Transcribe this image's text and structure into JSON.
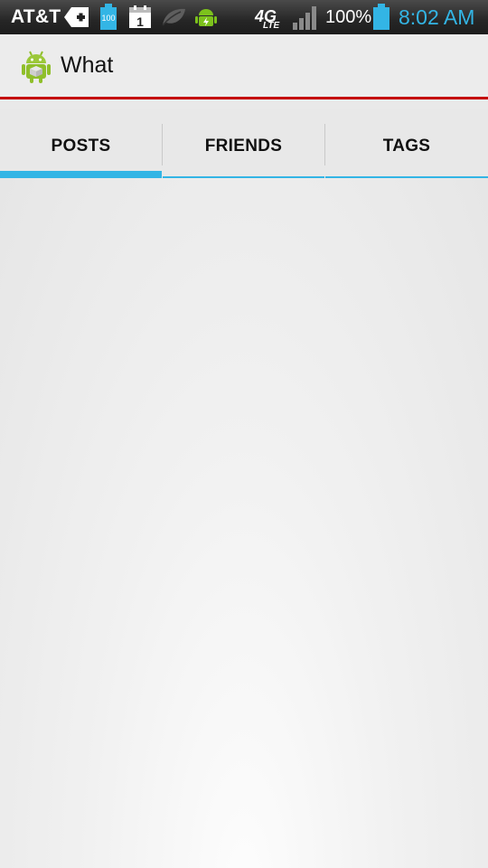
{
  "status_bar": {
    "carrier": "AT&T",
    "notification_icons": [
      "voicemail-icon",
      "storage-icon",
      "calendar-icon",
      "leaf-icon",
      "android-icon"
    ],
    "storage_level": "100",
    "calendar_day": "1",
    "network_main": "4G",
    "network_sub": "LTE",
    "battery_percent": "100%",
    "time": "8:02 AM",
    "time_color": "#33b5e5"
  },
  "action_bar": {
    "title": "What",
    "accent_color": "#c40000",
    "icon": "android-app-icon"
  },
  "tabs": [
    {
      "label": "POSTS",
      "selected": true
    },
    {
      "label": "FRIENDS",
      "selected": false
    },
    {
      "label": "TAGS",
      "selected": false
    }
  ],
  "tab_indicator_color": "#33b5e5"
}
